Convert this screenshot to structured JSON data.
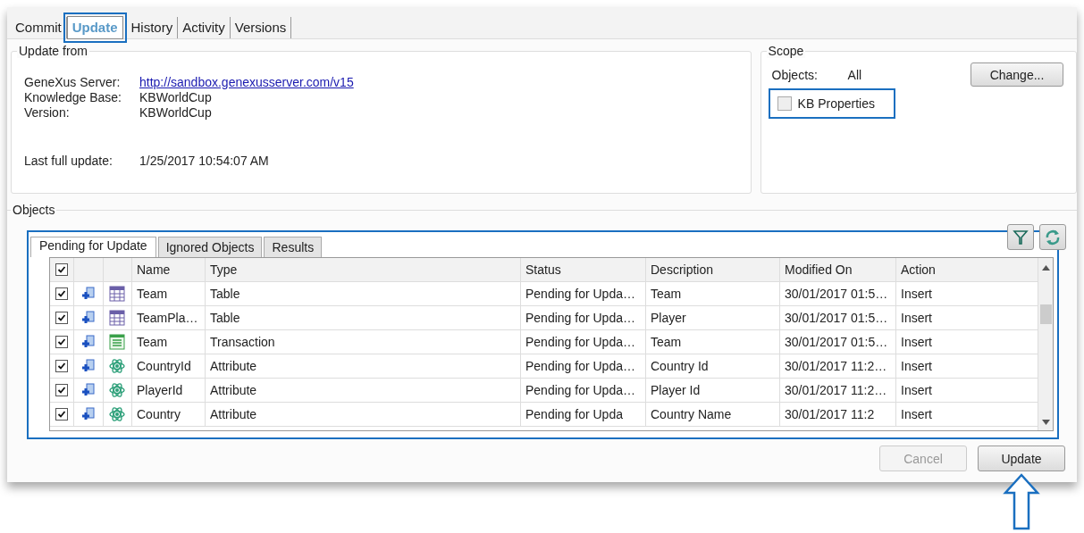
{
  "tabs": [
    {
      "label": "Commit",
      "selected": false,
      "highlighted": false
    },
    {
      "label": "Update",
      "selected": true,
      "highlighted": true
    },
    {
      "label": "History",
      "selected": false,
      "highlighted": false
    },
    {
      "label": "Activity",
      "selected": false,
      "highlighted": false
    },
    {
      "label": "Versions",
      "selected": false,
      "highlighted": false
    }
  ],
  "update_from": {
    "title": "Update from",
    "fields": [
      {
        "label": "GeneXus Server:",
        "value": "http://sandbox.genexusserver.com/v15",
        "kind": "link"
      },
      {
        "label": "Knowledge Base:",
        "value": "KBWorldCup",
        "kind": "text"
      },
      {
        "label": "Version:",
        "value": "KBWorldCup",
        "kind": "text"
      },
      {
        "label": "Last full update:",
        "value": "1/25/2017 10:54:07 AM",
        "kind": "spaced"
      }
    ]
  },
  "scope": {
    "title": "Scope",
    "objects_label": "Objects:",
    "objects_value": "All",
    "change_button": "Change...",
    "kb_properties": {
      "label": "KB Properties",
      "checked": false,
      "highlighted": true
    }
  },
  "objects": {
    "title": "Objects",
    "highlighted": true,
    "tabs": [
      {
        "label": "Pending for Update",
        "selected": true
      },
      {
        "label": "Ignored Objects",
        "selected": false
      },
      {
        "label": "Results",
        "selected": false
      }
    ],
    "all_checked": true,
    "columns": [
      "Name",
      "Type",
      "Status",
      "Description",
      "Modified On",
      "Action"
    ],
    "rows": [
      {
        "checked": true,
        "kind": "table",
        "cells": [
          "Team",
          "Table",
          "Pending for Upda…",
          "Team",
          "30/01/2017  01:5…",
          "Insert"
        ]
      },
      {
        "checked": true,
        "kind": "table",
        "cells": [
          "TeamPla…",
          "Table",
          "Pending for Upda…",
          "Player",
          "30/01/2017  01:5…",
          "Insert"
        ]
      },
      {
        "checked": true,
        "kind": "transaction",
        "cells": [
          "Team",
          "Transaction",
          "Pending for Upda…",
          "Team",
          "30/01/2017  01:5…",
          "Insert"
        ]
      },
      {
        "checked": true,
        "kind": "attribute",
        "cells": [
          "CountryId",
          "Attribute",
          "Pending for Upda…",
          "Country Id",
          "30/01/2017  11:2…",
          "Insert"
        ]
      },
      {
        "checked": true,
        "kind": "attribute",
        "cells": [
          "PlayerId",
          "Attribute",
          "Pending for Upda…",
          "Player Id",
          "30/01/2017  11:2…",
          "Insert"
        ]
      },
      {
        "checked": true,
        "kind": "attribute",
        "cells": [
          "Country",
          "Attribute",
          "Pending for Upda",
          "Country Name",
          "30/01/2017  11:2",
          "Insert"
        ]
      }
    ]
  },
  "buttons": [
    {
      "label": "Cancel",
      "disabled": true,
      "arrow": false
    },
    {
      "label": "Update",
      "disabled": false,
      "arrow": true
    }
  ]
}
